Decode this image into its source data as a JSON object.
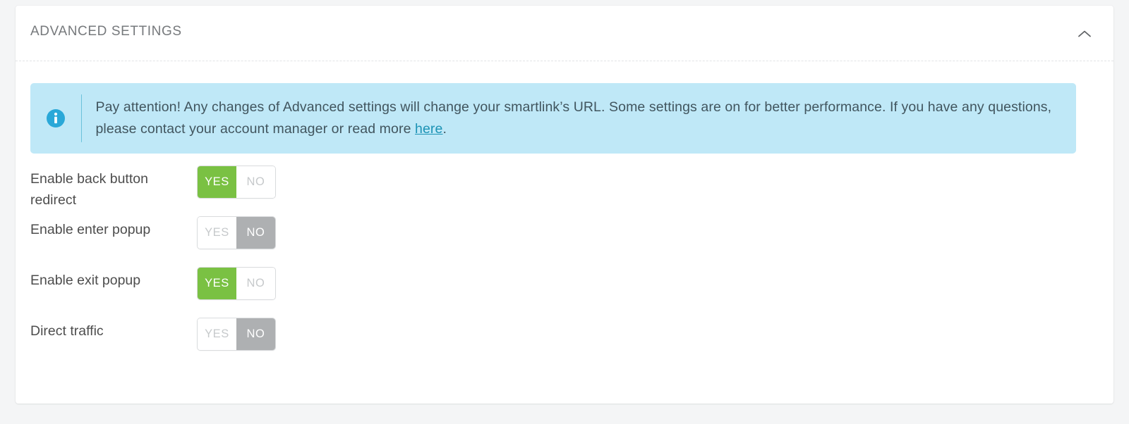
{
  "panel": {
    "title": "ADVANCED SETTINGS",
    "collapse_icon": "chevron-up-icon"
  },
  "banner": {
    "icon": "info-circle-icon",
    "text_before_link": "Pay attention! Any changes of Advanced settings will change your smartlink’s URL. Some settings are on for better performance. If you have any questions, please contact your account manager or read more ",
    "link_text": "here",
    "text_after_link": ".",
    "bg_color": "#bfe8f7",
    "text_color": "#41555e",
    "link_color": "#1c93b5"
  },
  "toggle_options": {
    "yes_label": "YES",
    "no_label": "NO",
    "yes_active_color": "#7ac143",
    "no_active_color": "#aeb0b2"
  },
  "settings": [
    {
      "label": "Enable back button redirect",
      "value": "YES"
    },
    {
      "label": "Enable enter popup",
      "value": "NO"
    },
    {
      "label": "Enable exit popup",
      "value": "YES"
    },
    {
      "label": "Direct traffic",
      "value": "NO"
    }
  ]
}
